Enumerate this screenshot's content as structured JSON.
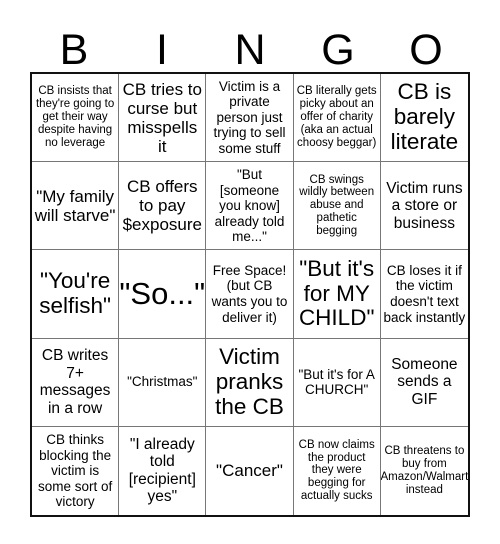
{
  "header": {
    "letters": [
      "B",
      "I",
      "N",
      "G",
      "O"
    ]
  },
  "cells": [
    {
      "text": "CB insists that they're going to get their way despite having no leverage"
    },
    {
      "text": "CB tries to curse but misspells it"
    },
    {
      "text": "Victim is a private person just trying to sell some stuff"
    },
    {
      "text": "CB literally gets picky about an offer of charity (aka an actual choosy beggar)"
    },
    {
      "text": "CB is barely literate"
    },
    {
      "text": "\"My family will starve\""
    },
    {
      "text": "CB offers to pay $exposure"
    },
    {
      "text": "\"But [someone you know] already told me...\""
    },
    {
      "text": "CB swings wildly between abuse and pathetic begging"
    },
    {
      "text": "Victim runs a store or business"
    },
    {
      "text": "\"You're selfish\""
    },
    {
      "text": "\"So...\""
    },
    {
      "text": "Free Space! (but CB wants you to deliver it)"
    },
    {
      "text": "\"But it's for MY CHILD\""
    },
    {
      "text": "CB loses it if the victim doesn't text back instantly"
    },
    {
      "text": "CB writes 7+ messages in a row"
    },
    {
      "text": "\"Christmas\""
    },
    {
      "text": "Victim pranks the CB"
    },
    {
      "text": "\"But it's for A CHURCH\""
    },
    {
      "text": "Someone sends a GIF"
    },
    {
      "text": "CB thinks blocking the victim is some sort of victory"
    },
    {
      "text": "\"I already told [recipient] yes\""
    },
    {
      "text": "\"Cancer\""
    },
    {
      "text": "CB now claims the product they were begging for actually sucks"
    },
    {
      "text": "CB threatens to buy from Amazon/Walmart instead"
    }
  ]
}
